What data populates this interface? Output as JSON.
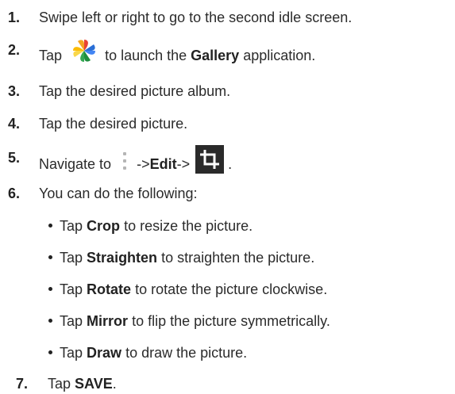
{
  "steps": [
    {
      "num": "1.",
      "text": "Swipe left or right to go to the second idle screen."
    },
    {
      "num": "2.",
      "pre": "Tap",
      "mid": "to launch the",
      "bold": "Gallery",
      "post": "application.",
      "icon": "google-photos-pinwheel-icon"
    },
    {
      "num": "3.",
      "text": "Tap the desired picture album."
    },
    {
      "num": "4.",
      "text": "Tap the desired picture."
    },
    {
      "num": "5.",
      "pre": "Navigate to",
      "arrow1": "->",
      "bold": "Edit",
      "arrow2": "->",
      "post": ".",
      "icons": [
        "more-vertical-icon",
        "crop-icon"
      ]
    },
    {
      "num": "6.",
      "text": "You can do the following:"
    },
    {
      "num": "7.",
      "pre": "Tap",
      "bold": "SAVE",
      "post": "."
    }
  ],
  "options": [
    {
      "pre": "Tap",
      "bold": "Crop",
      "post": "to resize the picture."
    },
    {
      "pre": "Tap",
      "bold": "Straighten",
      "post": "to straighten the picture."
    },
    {
      "pre": "Tap",
      "bold": "Rotate",
      "post": "to rotate the picture clockwise."
    },
    {
      "pre": "Tap",
      "bold": "Mirror",
      "post": "to flip the picture symmetrically."
    },
    {
      "pre": "Tap",
      "bold": "Draw",
      "post": "to draw the picture."
    }
  ],
  "colors": {
    "text": "#2b2b2b",
    "icon_dark": "#2a2a2a",
    "kebab_gray": "#b5b5b5",
    "pinwheel_red": "#e94235",
    "pinwheel_yellow": "#fbbc05",
    "pinwheel_green": "#34a853",
    "pinwheel_blue": "#4285f4"
  }
}
